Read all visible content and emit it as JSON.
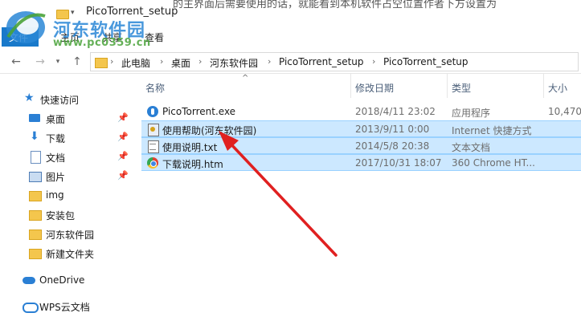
{
  "window": {
    "title": "PicoTorrent_setup",
    "title_extra": "的主界面后需要使用的话，就能看到本机软件占空位置作者下方设置为"
  },
  "ribbon": {
    "tabs": [
      {
        "label": "文件"
      },
      {
        "label": "主页"
      },
      {
        "label": "共享"
      },
      {
        "label": "查看"
      }
    ]
  },
  "watermark": {
    "brand": "河东软件园",
    "url": "www.pc0359.cn"
  },
  "nav": {
    "back_glyph": "←",
    "forward_glyph": "→",
    "recent_glyph": "▾",
    "up_glyph": "↑"
  },
  "breadcrumb": {
    "items": [
      "此电脑",
      "桌面",
      "河东软件园",
      "PicoTorrent_setup",
      "PicoTorrent_setup"
    ],
    "sep": "›"
  },
  "navpane": {
    "items": [
      {
        "label": "快速访问",
        "icon": "star-icon"
      },
      {
        "label": "桌面",
        "icon": "desktop-icon",
        "pinned": true
      },
      {
        "label": "下载",
        "icon": "download-icon",
        "pinned": true
      },
      {
        "label": "文档",
        "icon": "document-icon",
        "pinned": true
      },
      {
        "label": "图片",
        "icon": "pictures-icon",
        "pinned": true
      },
      {
        "label": "img",
        "icon": "folder-icon"
      },
      {
        "label": "安装包",
        "icon": "folder-icon"
      },
      {
        "label": "河东软件园",
        "icon": "folder-icon"
      },
      {
        "label": "新建文件夹",
        "icon": "folder-icon"
      },
      {
        "label": "OneDrive",
        "icon": "onedrive-icon"
      },
      {
        "label": "WPS云文档",
        "icon": "wps-cloud-icon"
      }
    ],
    "pin_glyph": "📌"
  },
  "filelist": {
    "columns": {
      "name": "名称",
      "date": "修改日期",
      "type": "类型",
      "size": "大小"
    },
    "sort_glyph": "^",
    "rows": [
      {
        "name": "PicoTorrent.exe",
        "date": "2018/4/11 23:02",
        "type": "应用程序",
        "size": "10,470",
        "icon": "exe-icon",
        "selected": false
      },
      {
        "name": "使用帮助(河东软件园)",
        "date": "2013/9/11 0:00",
        "type": "Internet 快捷方式",
        "size": "",
        "icon": "chm-icon",
        "selected": true
      },
      {
        "name": "使用说明.txt",
        "date": "2014/5/8 20:38",
        "type": "文本文档",
        "size": "",
        "icon": "txt-icon",
        "selected": true
      },
      {
        "name": "下载说明.htm",
        "date": "2017/10/31 18:07",
        "type": "360 Chrome HT...",
        "size": "",
        "icon": "htm-icon",
        "selected": true
      }
    ]
  },
  "colors": {
    "accent": "#1979ca",
    "selection": "#cce8ff",
    "arrow": "#e02020"
  }
}
